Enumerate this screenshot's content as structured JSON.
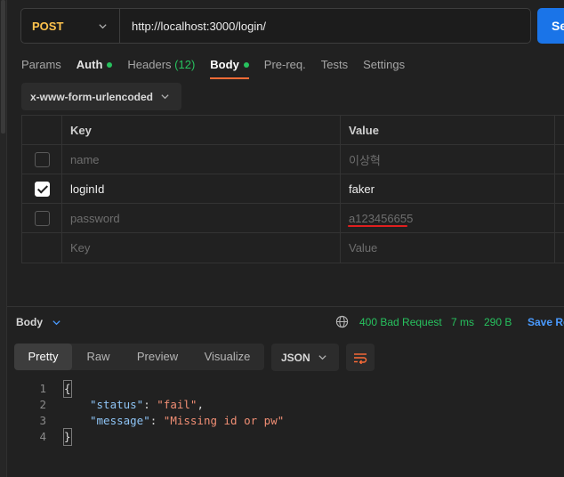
{
  "request": {
    "method": "POST",
    "url": "http://localhost:3000/login/",
    "send_label": "Se"
  },
  "tabs": [
    {
      "label": "Params"
    },
    {
      "label": "Auth",
      "dot": true
    },
    {
      "label": "Headers",
      "count": "(12)"
    },
    {
      "label": "Body",
      "dot": true
    },
    {
      "label": "Pre-req."
    },
    {
      "label": "Tests"
    },
    {
      "label": "Settings"
    }
  ],
  "body_type": "x-www-form-urlencoded",
  "table": {
    "headers": {
      "key": "Key",
      "value": "Value"
    },
    "rows": [
      {
        "checked": false,
        "key": "name",
        "value": "이상혁"
      },
      {
        "checked": true,
        "key": "loginId",
        "value": "faker"
      },
      {
        "checked": false,
        "key": "password",
        "value": "a123456655"
      }
    ],
    "placeholder": {
      "key": "Key",
      "value": "Value"
    }
  },
  "response": {
    "label": "Body",
    "status": "400 Bad Request",
    "time": "7 ms",
    "size": "290 B",
    "save_label": "Save Re",
    "view_tabs": [
      "Pretty",
      "Raw",
      "Preview",
      "Visualize"
    ],
    "format": "JSON",
    "code": {
      "line_numbers": [
        "1",
        "2",
        "3",
        "4"
      ],
      "open_brace": "{",
      "close_brace": "}",
      "fields": [
        {
          "key": "\"status\"",
          "value": "\"fail\"",
          "trail": ","
        },
        {
          "key": "\"message\"",
          "value": "\"Missing id or pw\"",
          "trail": ""
        }
      ]
    }
  },
  "colors": {
    "method": "#ffc34d",
    "send": "#1a74e8",
    "active_tab_underline": "#ff6c37",
    "status_ok_dot": "#27c25e",
    "status_text": "#27c25e",
    "json_key": "#8ec4f5",
    "json_string": "#f08e74",
    "annotation_underline": "#e01f1f"
  }
}
